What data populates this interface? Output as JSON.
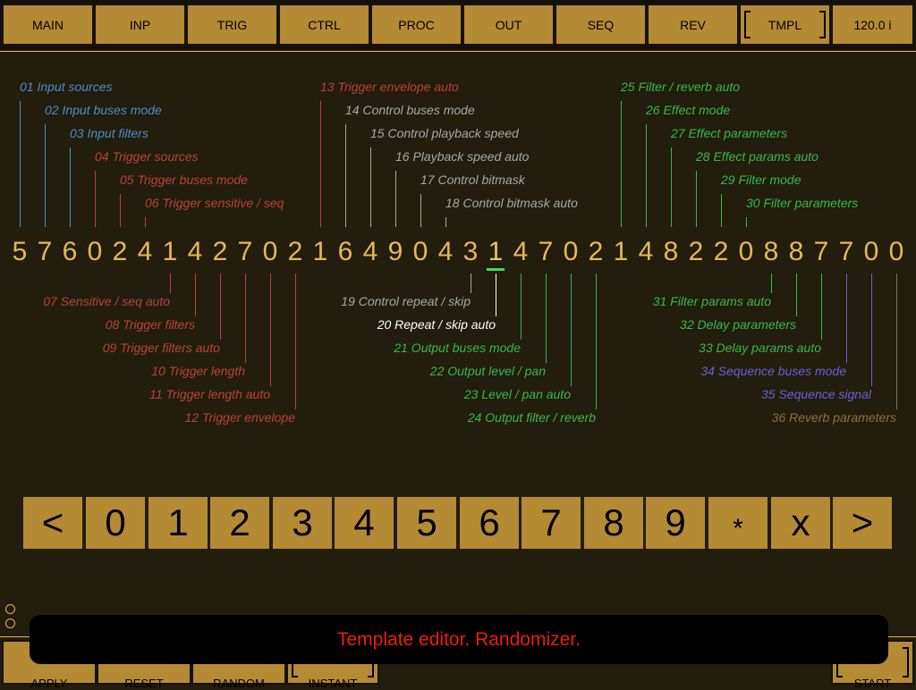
{
  "top_tabs": [
    "MAIN",
    "INP",
    "TRIG",
    "CTRL",
    "PROC",
    "OUT",
    "SEQ",
    "REV",
    "TMPL",
    "120.0 i"
  ],
  "param_labels": {
    "p01": "01 Input sources",
    "p02": "02 Input buses mode",
    "p03": "03 Input filters",
    "p04": "04 Trigger sources",
    "p05": "05 Trigger buses mode",
    "p06": "06 Trigger sensitive / seq",
    "p07": "07 Sensitive / seq auto",
    "p08": "08 Trigger filters",
    "p09": "09 Trigger filters auto",
    "p10": "10 Trigger length",
    "p11": "11 Trigger length auto",
    "p12": "12 Trigger envelope",
    "p13": "13 Trigger envelope auto",
    "p14": "14 Control buses mode",
    "p15": "15 Control playback speed",
    "p16": "16 Playback speed auto",
    "p17": "17 Control bitmask",
    "p18": "18 Control bitmask auto",
    "p19": "19 Control repeat / skip",
    "p20": "20 Repeat / skip auto",
    "p21": "21 Output buses mode",
    "p22": "22 Output level / pan",
    "p23": "23 Level / pan auto",
    "p24": "24 Output filter / reverb",
    "p25": "25 Filter / reverb auto",
    "p26": "26 Effect mode",
    "p27": "27 Effect parameters",
    "p28": "28 Effect params auto",
    "p29": "29 Filter mode",
    "p30": "30 Filter parameters",
    "p31": "31 Filter params auto",
    "p32": "32 Delay parameters",
    "p33": "33 Delay params auto",
    "p34": "34 Sequence buses mode",
    "p35": "35 Sequence signal",
    "p36": "36 Reverb parameters"
  },
  "template_digits": [
    "5",
    "7",
    "6",
    "0",
    "2",
    "4",
    "1",
    "4",
    "2",
    "7",
    "0",
    "2",
    "1",
    "6",
    "4",
    "9",
    "0",
    "4",
    "3",
    "1",
    "4",
    "7",
    "0",
    "2",
    "1",
    "4",
    "8",
    "2",
    "2",
    "0",
    "8",
    "8",
    "7",
    "7",
    "0",
    "0"
  ],
  "selected_digit_index": 19,
  "keypad": [
    "<",
    "0",
    "1",
    "2",
    "3",
    "4",
    "5",
    "6",
    "7",
    "8",
    "9",
    "*",
    "x",
    ">"
  ],
  "bottom_buttons": [
    "APPLY",
    "RESET",
    "RANDOM",
    "INSTANT",
    "START"
  ],
  "toast_message": "Template editor. Randomizer.",
  "colors": {
    "input": "#4a8ec8",
    "trigger": "#b84438",
    "control": "#a8a8a8",
    "highlight": "#ffffff",
    "output": "#38b848",
    "sequence": "#6a5ed8",
    "reverb": "#8a7048",
    "accent": "#b58a34"
  }
}
